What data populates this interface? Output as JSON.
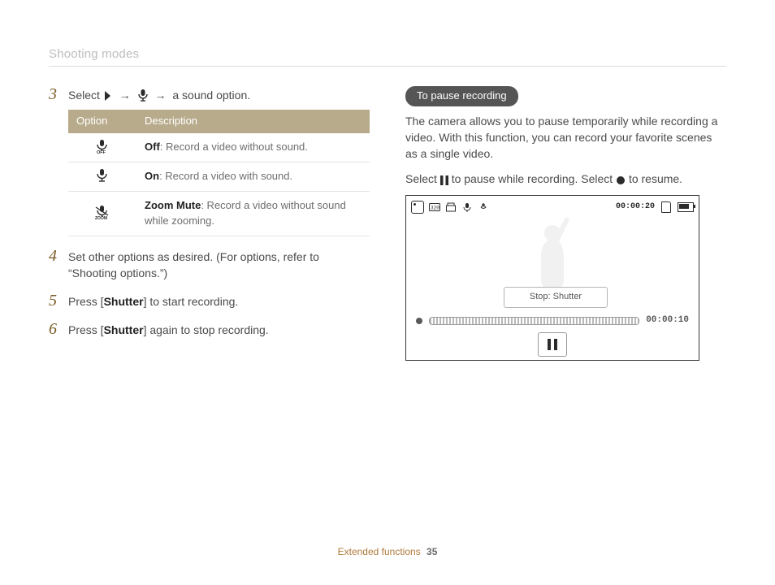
{
  "header": {
    "section_title": "Shooting modes"
  },
  "left": {
    "step3": {
      "num": "3",
      "pre": "Select",
      "post": "a sound option.",
      "table": {
        "header_option": "Option",
        "header_desc": "Description",
        "rows": [
          {
            "icon": "mic-off-icon",
            "label": "Off",
            "text": ": Record a video without sound."
          },
          {
            "icon": "mic-on-icon",
            "label": "On",
            "text": ": Record a video with sound."
          },
          {
            "icon": "mic-zoom-icon",
            "label": "Zoom Mute",
            "text": ": Record a video without sound while zooming."
          }
        ]
      }
    },
    "step4": {
      "num": "4",
      "text": "Set other options as desired. (For options, refer to “Shooting options.”)"
    },
    "step5": {
      "num": "5",
      "pre": "Press [",
      "bold": "Shutter",
      "post": "] to start recording."
    },
    "step6": {
      "num": "6",
      "pre": "Press [",
      "bold": "Shutter",
      "post": "] again to stop recording."
    }
  },
  "right": {
    "pill": "To pause recording",
    "para": "The camera allows you to pause temporarily while recording a video. With this function, you can record your favorite scenes as a single video.",
    "instr_pre": "Select ",
    "instr_mid": " to pause while recording. Select ",
    "instr_post": " to resume.",
    "screen": {
      "top_time": "00:00:20",
      "caption": "Stop: Shutter",
      "elapsed": "00:00:10"
    }
  },
  "footer": {
    "label": "Extended functions",
    "page": "35"
  }
}
